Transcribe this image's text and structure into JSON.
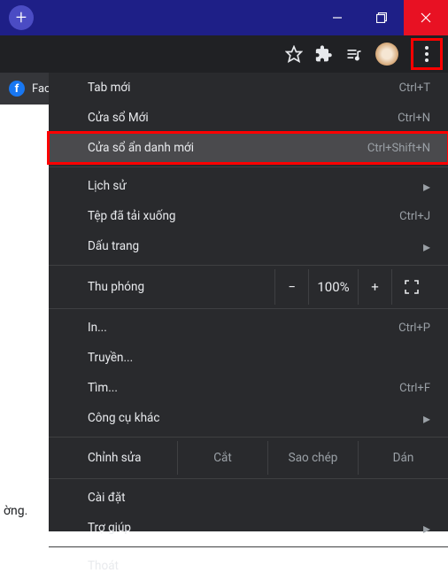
{
  "titlebar": {
    "new_tab_plus": "+"
  },
  "tab": {
    "label": "Fac",
    "fb_letter": "f"
  },
  "menu": {
    "new_tab": "Tab mới",
    "new_tab_sc": "Ctrl+T",
    "new_window": "Cửa sổ Mới",
    "new_window_sc": "Ctrl+N",
    "incognito": "Cửa sổ ẩn danh mới",
    "incognito_sc": "Ctrl+Shift+N",
    "history": "Lịch sử",
    "downloads": "Tệp đã tải xuống",
    "downloads_sc": "Ctrl+J",
    "bookmarks": "Dấu trang",
    "zoom_label": "Thu phóng",
    "zoom_minus": "−",
    "zoom_pct": "100%",
    "zoom_plus": "+",
    "print": "In...",
    "print_sc": "Ctrl+P",
    "cast": "Truyền...",
    "find": "Tìm...",
    "find_sc": "Ctrl+F",
    "more_tools": "Công cụ khác",
    "edit_label": "Chỉnh sửa",
    "cut": "Cắt",
    "copy": "Sao chép",
    "paste": "Dán",
    "settings": "Cài đặt",
    "help": "Trợ giúp",
    "exit": "Thoát",
    "chev": "▸"
  },
  "page": {
    "fragment": "ờng."
  }
}
